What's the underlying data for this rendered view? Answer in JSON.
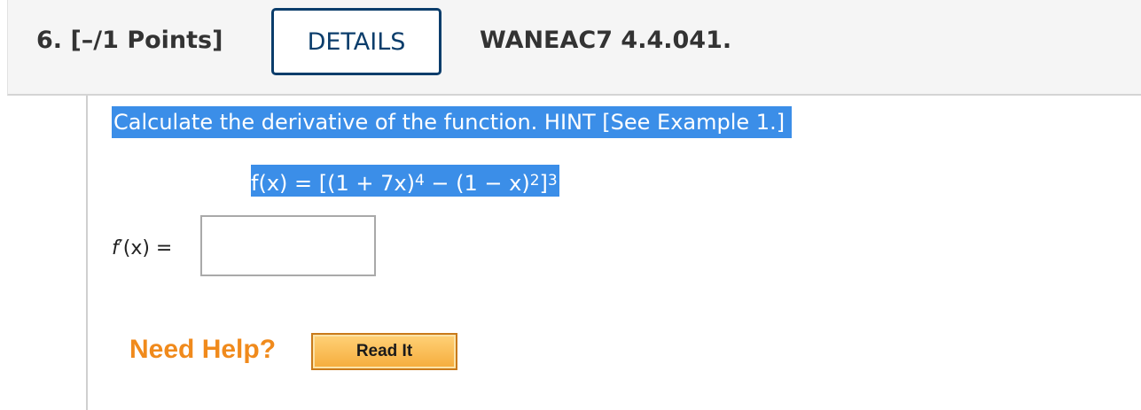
{
  "question": {
    "number_label": "6. [–/1 Points]",
    "details_label": "DETAILS",
    "code": "WANEAC7 4.4.041."
  },
  "problem": {
    "prompt": "Calculate the derivative of the function. HINT [See Example 1.]",
    "formula": {
      "lhs": "f(x) = [(1 + 7x)",
      "exp1": "4",
      "mid": " − (1 − x)",
      "exp2": "2",
      "close": "]",
      "exp3": "3"
    }
  },
  "answer": {
    "label_f": "f",
    "label_rest": "′(x)  =",
    "value": ""
  },
  "help": {
    "need_help_label": "Need Help?",
    "read_it_label": "Read It"
  },
  "colors": {
    "selection": "#3b8ee8",
    "details_border": "#0b3d6b",
    "need_help": "#f08a1c",
    "read_it_fill": "#f5ac3b"
  }
}
